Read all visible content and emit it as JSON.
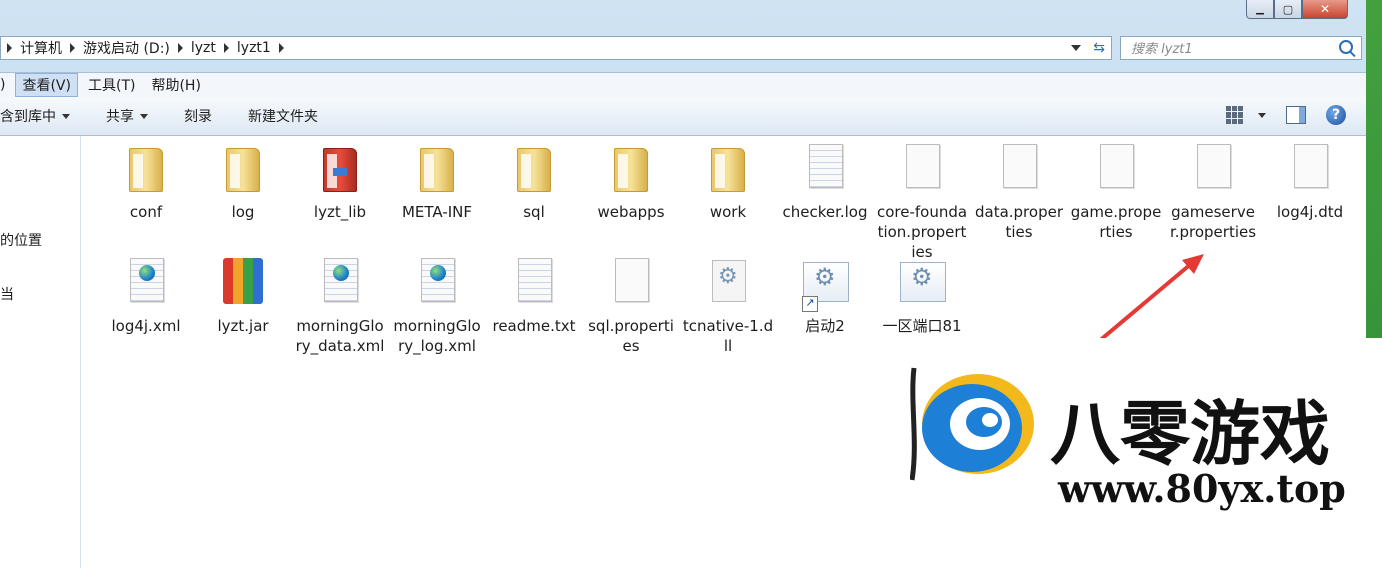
{
  "window": {
    "minimize": "▁",
    "maximize": "▢",
    "close": "✕"
  },
  "address": {
    "crumbs": [
      "计算机",
      "游戏启动 (D:)",
      "lyzt",
      "lyzt1"
    ]
  },
  "search": {
    "placeholder": "搜索 lyzt1"
  },
  "menu": [
    {
      "label": ")"
    },
    {
      "label": "查看(V)"
    },
    {
      "label": "工具(T)"
    },
    {
      "label": "帮助(H)"
    }
  ],
  "toolbar": {
    "library": "含到库中",
    "share": "共享",
    "burn": "刻录",
    "new_folder": "新建文件夹",
    "help": "?"
  },
  "nav": {
    "recent": "的位置",
    "item2": "当"
  },
  "files": [
    {
      "name": "conf",
      "type": "folder"
    },
    {
      "name": "log",
      "type": "folder"
    },
    {
      "name": "lyzt_lib",
      "type": "folder-red"
    },
    {
      "name": "META-INF",
      "type": "folder"
    },
    {
      "name": "sql",
      "type": "folder"
    },
    {
      "name": "webapps",
      "type": "folder"
    },
    {
      "name": "work",
      "type": "folder"
    },
    {
      "name": "checker.log",
      "type": "text"
    },
    {
      "name": "core-foundation.properties",
      "type": "file"
    },
    {
      "name": "data.properties",
      "type": "file"
    },
    {
      "name": "game.properties",
      "type": "file"
    },
    {
      "name": "gameserver.properties",
      "type": "file"
    },
    {
      "name": "log4j.dtd",
      "type": "file"
    },
    {
      "name": "log4j.xml",
      "type": "xml"
    },
    {
      "name": "lyzt.jar",
      "type": "jar"
    },
    {
      "name": "morningGlory_data.xml",
      "type": "xml"
    },
    {
      "name": "morningGlory_log.xml",
      "type": "xml"
    },
    {
      "name": "readme.txt",
      "type": "text"
    },
    {
      "name": "sql.properties",
      "type": "file"
    },
    {
      "name": "tcnative-1.dll",
      "type": "dll"
    },
    {
      "name": "启动2",
      "type": "shortcut"
    },
    {
      "name": "一区端口81",
      "type": "exe"
    }
  ],
  "watermark": {
    "title": "八零游戏",
    "url": "www.80yx.top"
  },
  "colors": {
    "arrow": "#e53935",
    "accent": "#2d6db4"
  }
}
